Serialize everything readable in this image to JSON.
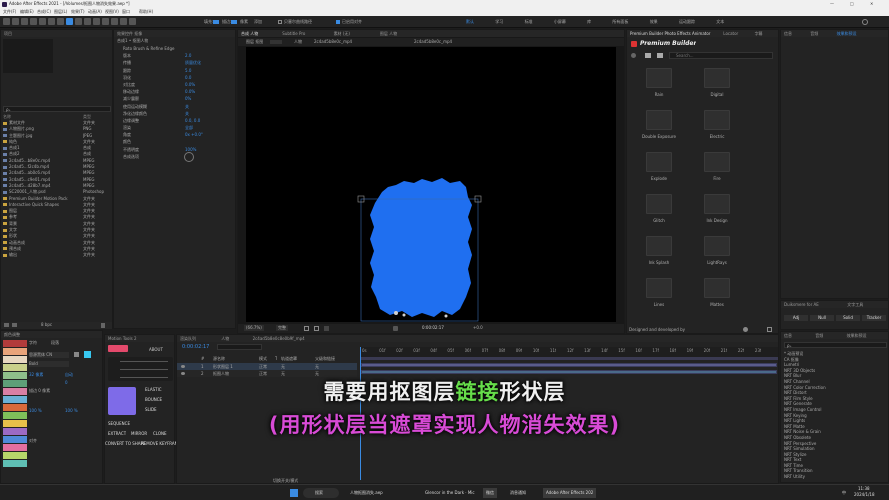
{
  "title_bar": {
    "title": "Adobe After Effects 2021 - [/Volumes/抠图人物消失效果.aep *]",
    "controls": [
      "—",
      "□",
      "✕"
    ]
  },
  "menu": [
    "文件(F)",
    "编辑(E)",
    "合成(C)",
    "图层(L)",
    "效果(T)",
    "动画(A)",
    "视图(V)",
    "窗口",
    "帮助(H)"
  ],
  "toolbar": {
    "options": [
      "填充:",
      "描边:",
      "像素",
      "添加"
    ],
    "checkbox1": "贝塞尔曲线路径",
    "checkbox2": "已启用对齐",
    "workspaces": [
      "默认",
      "学习",
      "标准",
      "小屏幕",
      "库",
      "所有面板",
      "效果",
      "运动跟踪",
      "文本"
    ]
  },
  "project": {
    "header": "项目",
    "search_placeholder": "ρ₊",
    "col_name": "名称",
    "col_type": "类型",
    "items": [
      {
        "name": "素材文件",
        "type": "文件夹"
      },
      {
        "name": "人物图片.png",
        "type": "PNG"
      },
      {
        "name": "主题图片.jpg",
        "type": "JPEG"
      },
      {
        "name": "纯色",
        "type": "文件夹"
      },
      {
        "name": "合成1",
        "type": "合成"
      },
      {
        "name": "合成2",
        "type": "合成"
      },
      {
        "name": "2c4ad5...b8e0c.mp4",
        "type": "MPEG"
      },
      {
        "name": "2c4ad5...f2c4b.mp4",
        "type": "MPEG"
      },
      {
        "name": "2c4ad5...ab0c6.mp4",
        "type": "MPEG"
      },
      {
        "name": "2c4ad5...c9e01.mp4",
        "type": "MPEG"
      },
      {
        "name": "2c4ad5...d28b7.mp4",
        "type": "MPEG"
      },
      {
        "name": "SC20001_人物.psd",
        "type": "Photoshop"
      },
      {
        "name": "Premium Builder Motion Pack",
        "type": "文件夹"
      },
      {
        "name": "Interactive Quick Shapes",
        "type": "文件夹"
      },
      {
        "name": "图层",
        "type": "文件夹"
      },
      {
        "name": "参考",
        "type": "文件夹"
      },
      {
        "name": "背景",
        "type": "文件夹"
      },
      {
        "name": "文字",
        "type": "文件夹"
      },
      {
        "name": "形状",
        "type": "文件夹"
      },
      {
        "name": "动画合成",
        "type": "文件夹"
      },
      {
        "name": "预合成",
        "type": "文件夹"
      },
      {
        "name": "输出",
        "type": "文件夹"
      }
    ],
    "bpc": "8 bpc"
  },
  "effect_controls": {
    "tab": "效果控件 抠像",
    "layer": "合成1 • 抠图人物",
    "rows": [
      {
        "label": "Roto Brush & Refine Edge",
        "value": ""
      },
      {
        "label": "版本",
        "value": "2.0"
      },
      {
        "label": "传播",
        "value": "质量优化"
      },
      {
        "label": "跟踪",
        "value": "5.0"
      },
      {
        "label": "羽化",
        "value": "0.0"
      },
      {
        "label": "对比度",
        "value": "0.0%"
      },
      {
        "label": "移动边缘",
        "value": "0.0%"
      },
      {
        "label": "减少震颤",
        "value": "0%"
      },
      {
        "label": "使用运动模糊",
        "value": "关"
      },
      {
        "label": "净化边缘颜色",
        "value": "关"
      },
      {
        "label": "边缘调整",
        "value": "0.0, 0.0"
      },
      {
        "label": "渲染",
        "value": "全部"
      },
      {
        "label": "角度",
        "value": "0x +0.0°"
      },
      {
        "label": "颜色",
        "value": ""
      },
      {
        "label": "不透明度",
        "value": "100%"
      },
      {
        "label": "合成选项",
        "value": ""
      }
    ]
  },
  "viewer": {
    "tabs": [
      "合成 人物",
      "Subtitle Pro",
      "素材 (无)",
      "图层 人物"
    ],
    "breadcrumb": [
      "人物",
      "2c4ad5b8e0c_mp4",
      "2c4ad5b8e0c_mp4"
    ],
    "layer_label": "图层 抠图",
    "zoom": "(66.7%)",
    "quality": "完整",
    "timecode": "0:00:02:17",
    "frame": "+0.0"
  },
  "premium_builder": {
    "tabs": [
      "Premium Builder Photo Effects Animator",
      "Locator",
      "字幕"
    ],
    "title": "Premium Builder",
    "search_placeholder": "Search...",
    "folders": [
      "Rain",
      "Digital",
      "Double Exposure",
      "Electric",
      "Explode",
      "Fire",
      "Glitch",
      "Ink Design",
      "Ink Splash",
      "LightRays",
      "Lines",
      "Mattes"
    ],
    "footer": "Designed and developed by"
  },
  "right_panels": {
    "tabs": [
      "信息",
      "音频",
      "效果和预设"
    ],
    "shape_tabs": [
      "Duiksmere for AE",
      "文字工具"
    ],
    "shape_buttons": [
      "Adj",
      "Null",
      "Solid",
      "Tracker"
    ],
    "fx_search": "ρ₊",
    "fx_items": [
      "* 动画预设",
      "CA 抠像",
      "Lumetri",
      "NRT 3D Objects",
      "NRT Blur",
      "NRT Channel",
      "NRT Color Correction",
      "NRT Distort",
      "NRT Film Style",
      "NRT Generate",
      "NRT Image Control",
      "NRT Keying",
      "NRT Lights",
      "NRT Matte",
      "NRT Noise & Grain",
      "NRT Obsolete",
      "NRT Perspective",
      "NRT Simulation",
      "NRT Stylize",
      "NRT Text",
      "NRT Time",
      "NRT Transition",
      "NRT Utility"
    ]
  },
  "character": {
    "tabs": [
      "颜色调整",
      "字符",
      "段落"
    ],
    "font": "思源黑体 CN",
    "style": "Bold",
    "size": "32 像素",
    "leading": "自动",
    "tracking": "0",
    "scale_h": "100 %",
    "scale_v": "100 %",
    "stroke": "描边 0 像素",
    "paragraph": "对齐"
  },
  "motion_tools": {
    "tab": "Motion Tools 2",
    "about": "ABOUT",
    "labels": [
      "ELASTIC",
      "BOUNCE",
      "SLIDE",
      "SEQUENCE",
      "EXTRACT",
      "MIRROR",
      "CLONE",
      "CONVERT TO SHAPE",
      "REMOVE KEYFRAMES"
    ]
  },
  "timeline": {
    "tabs": [
      "渲染队列",
      "人物",
      "2c4ad5b8e0c8e0b9f_mp4"
    ],
    "timecode": "0:00:02:17",
    "columns": [
      "#",
      "源名称",
      "模式",
      "T",
      "轨道遮罩",
      "父级和链接"
    ],
    "layers": [
      {
        "num": "1",
        "name": "形状图层 1",
        "mode": "正常",
        "matte": "无",
        "parent": "无"
      },
      {
        "num": "2",
        "name": "抠图人物",
        "mode": "正常",
        "matte": "无",
        "parent": "无"
      }
    ],
    "ticks": [
      "0s",
      "01f",
      "02f",
      "03f",
      "04f",
      "05f",
      "06f",
      "07f",
      "08f",
      "09f",
      "10f",
      "11f",
      "12f",
      "13f",
      "14f",
      "15f",
      "16f",
      "17f",
      "18f",
      "19f",
      "20f",
      "21f",
      "22f",
      "23f"
    ],
    "footer": "切换开关/模式"
  },
  "subtitle": {
    "line1_parts": [
      {
        "text": "需要用抠图层",
        "highlight": false
      },
      {
        "text": "链接",
        "highlight": true
      },
      {
        "text": "形状层",
        "highlight": false
      }
    ],
    "line2": "(用形状层当遮罩实现人物消失效果)"
  },
  "taskbar": {
    "search": "搜索",
    "items": [
      "人物抠图消失.aep",
      "Glencor in the Dark · Mic",
      "微信",
      "消息通知",
      "Adobe After Effects 202"
    ],
    "time": "11:38",
    "date": "2024/1/18",
    "lang": "中"
  },
  "colors": {
    "accent": "#3a8be2",
    "blob": "#1f6ff0",
    "caption_highlight": "#66dd4a",
    "caption_pink": "#d84bd6"
  }
}
